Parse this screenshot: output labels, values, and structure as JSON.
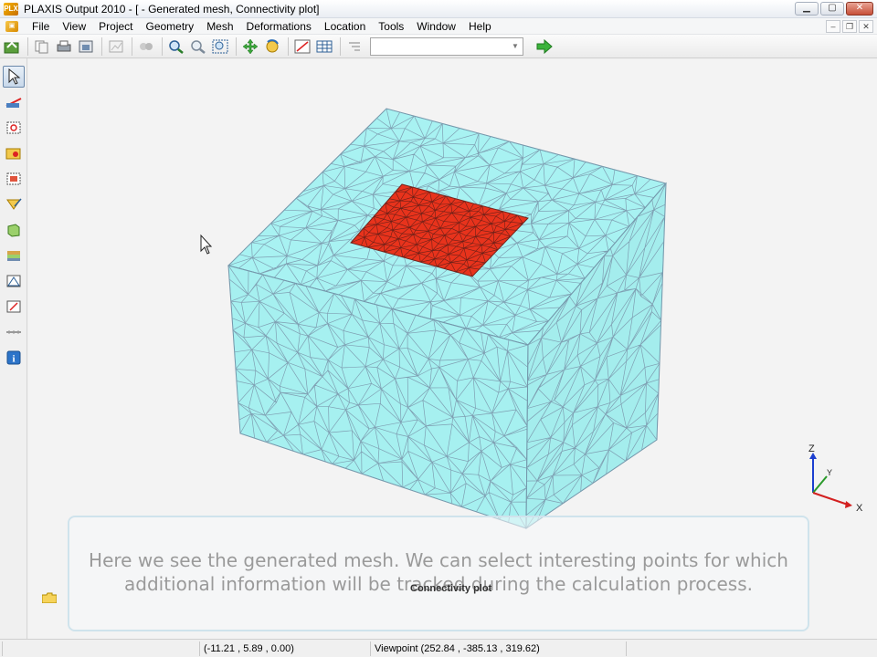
{
  "window": {
    "title": "PLAXIS Output 2010 - [ - Generated mesh, Connectivity plot]",
    "app_icon_text": "PLX",
    "minimize": "▁",
    "maximize": "▢",
    "close": "✕"
  },
  "menu": {
    "items": [
      "File",
      "View",
      "Project",
      "Geometry",
      "Mesh",
      "Deformations",
      "Location",
      "Tools",
      "Window",
      "Help"
    ],
    "mdi_minimize": "–",
    "mdi_restore": "❐",
    "mdi_close": "✕"
  },
  "toolbar": {
    "combo_value": "",
    "icons": [
      "open-project-icon",
      "copy-icon",
      "print-icon",
      "export-icon",
      "chart-icon",
      "hide-icon",
      "zoom-in-icon",
      "zoom-out-icon",
      "zoom-window-icon",
      "pan-icon",
      "rotate-icon",
      "scale-icon",
      "table-icon",
      "legend-icon",
      "go-arrow-icon"
    ]
  },
  "left_toolbar": {
    "icons": [
      "select-pointer-icon",
      "cross-section-icon",
      "select-points-icon",
      "curve-points-icon",
      "node-select-icon",
      "draw-check-icon",
      "structure-icon",
      "soil-layer-icon",
      "distribution-icon",
      "annotation-icon",
      "ruler-icon",
      "info-icon"
    ]
  },
  "axes": {
    "z": "Z",
    "y": "Y",
    "x": "X"
  },
  "caption": {
    "line1": "Here we see the generated mesh. We can select interesting points for which",
    "line2": "additional information will be tracked during the calculation process."
  },
  "plot_label": "Connectivity plot",
  "statusbar": {
    "cursor_coords": "(-11.21 , 5.89 , 0.00)",
    "viewpoint": "Viewpoint (252.84 , -385.13 , 319.62)"
  },
  "colors": {
    "mesh_fill": "#a8f2f2",
    "mesh_line": "#6f94a8",
    "loaded_area": "#e8331c",
    "canvas_bg": "#f3f3f3"
  }
}
